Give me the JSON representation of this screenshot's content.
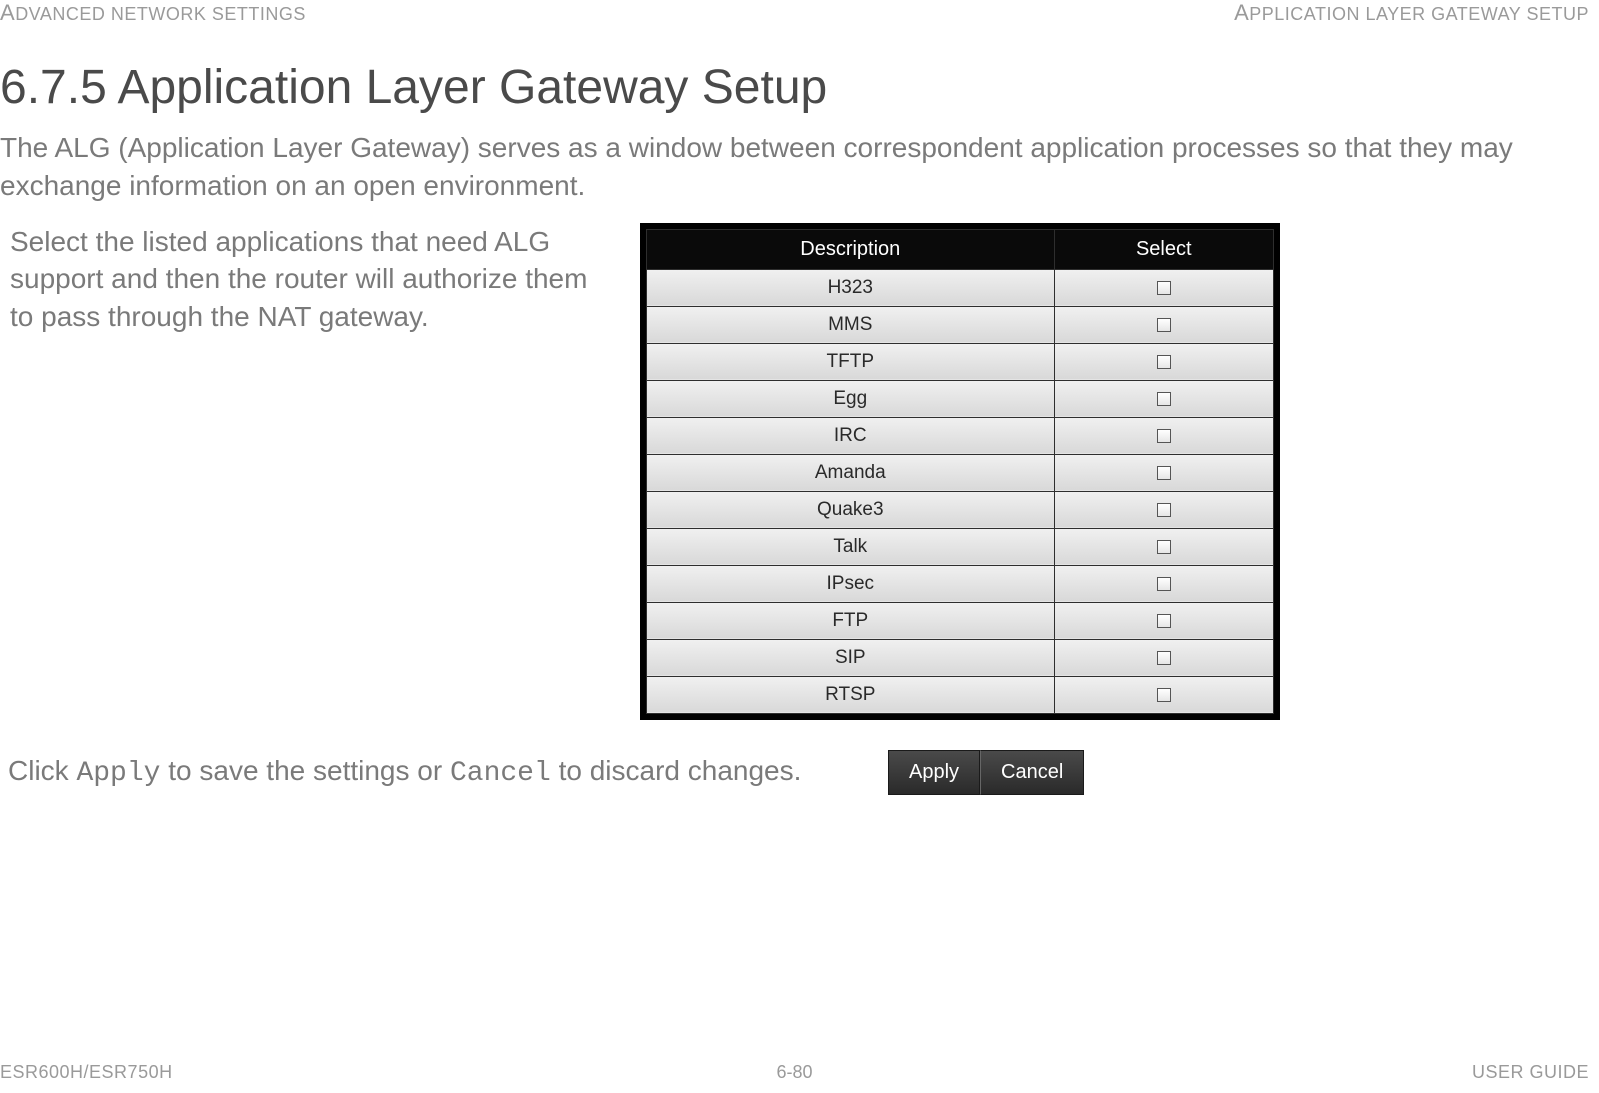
{
  "header": {
    "left": "ADVANCED NETWORK SETTINGS",
    "right": "APPLICATION LAYER GATEWAY SETUP"
  },
  "title": "6.7.5 Application Layer Gateway Setup",
  "intro": "The ALG (Application Layer Gateway) serves as a window between correspondent application processes so that they may exchange information on an open environment.",
  "left_instruction": "Select the listed applications that need ALG support and then the router will authorize them to pass through the NAT gateway.",
  "table": {
    "headers": {
      "description": "Description",
      "select": "Select"
    },
    "rows": [
      {
        "desc": "H323",
        "checked": false
      },
      {
        "desc": "MMS",
        "checked": false
      },
      {
        "desc": "TFTP",
        "checked": false
      },
      {
        "desc": "Egg",
        "checked": false
      },
      {
        "desc": "IRC",
        "checked": false
      },
      {
        "desc": "Amanda",
        "checked": false
      },
      {
        "desc": "Quake3",
        "checked": false
      },
      {
        "desc": "Talk",
        "checked": false
      },
      {
        "desc": "IPsec",
        "checked": false
      },
      {
        "desc": "FTP",
        "checked": false
      },
      {
        "desc": "SIP",
        "checked": false
      },
      {
        "desc": "RTSP",
        "checked": false
      }
    ]
  },
  "actions": {
    "text_prefix": "Click ",
    "apply_code": "Apply",
    "text_mid": " to save the settings or ",
    "cancel_code": "Cancel",
    "text_suffix": " to discard changes.",
    "apply_label": "Apply",
    "cancel_label": "Cancel"
  },
  "footer": {
    "left": "ESR600H/ESR750H",
    "center": "6-80",
    "right": "USER GUIDE"
  }
}
